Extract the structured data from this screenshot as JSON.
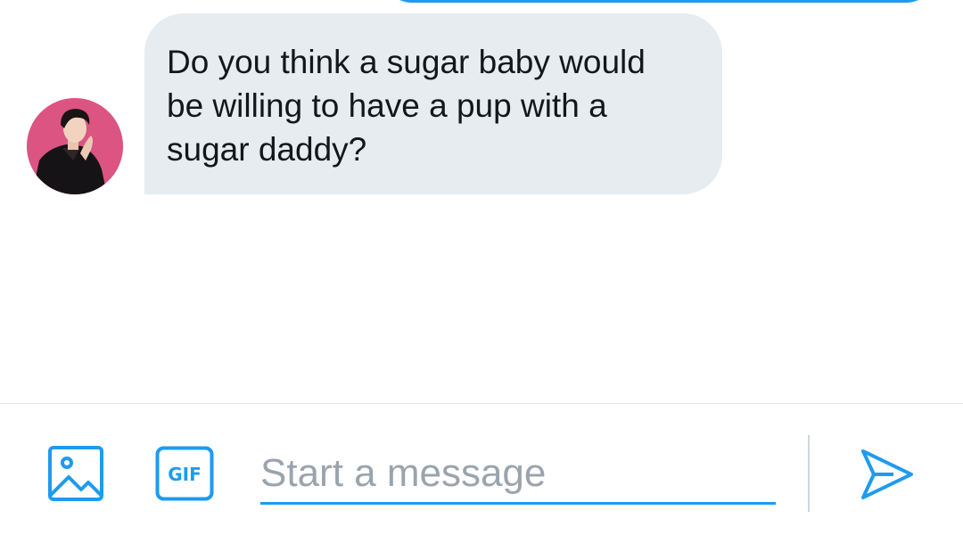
{
  "conversation": {
    "received_message": {
      "text": "Do you think a sugar baby would be willing to have a pup with a sugar daddy?",
      "avatar": "sender-avatar-photo"
    }
  },
  "composer": {
    "placeholder": "Start a message",
    "media_icon": "image-icon",
    "gif_label": "GIF",
    "send_icon": "send-icon"
  },
  "colors": {
    "accent": "#1d9bf0",
    "bubble_background": "#e6ecf0",
    "text": "#14171a",
    "placeholder": "#9aa4ad",
    "avatar_background": "#d94f7c"
  }
}
